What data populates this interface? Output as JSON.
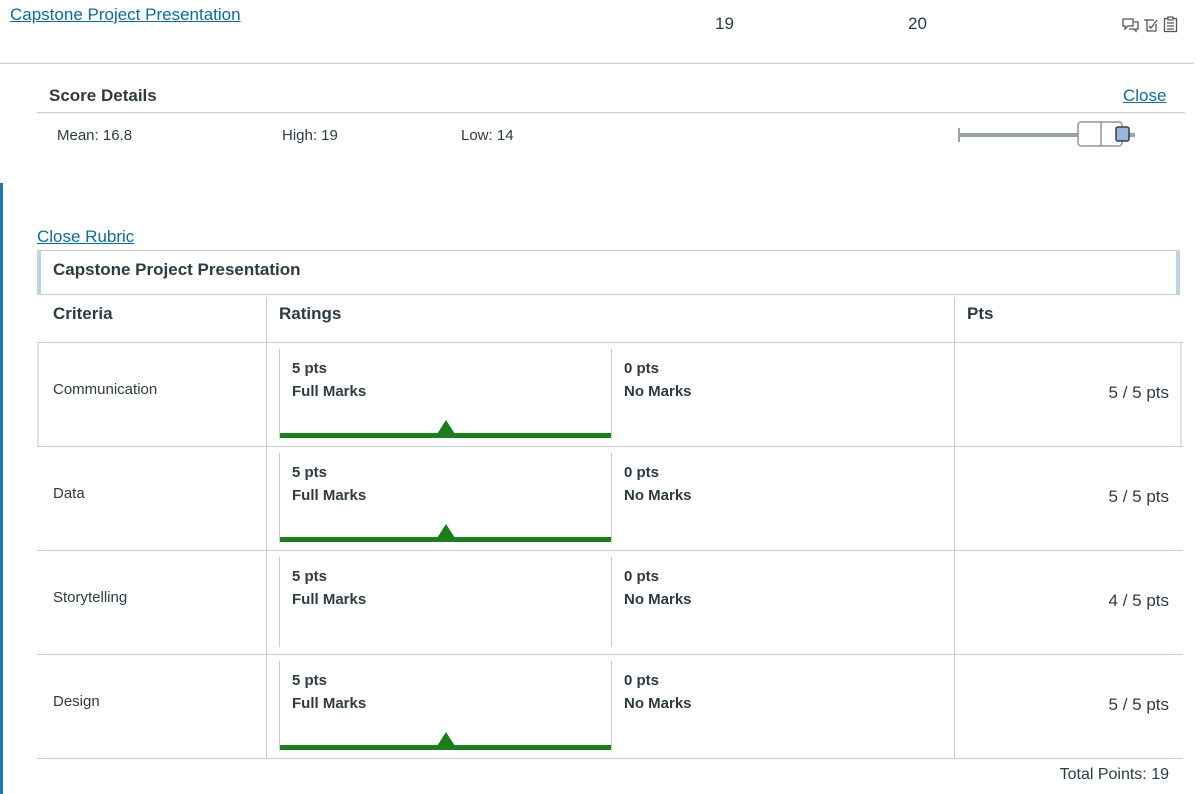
{
  "assignment": {
    "title": "Capstone Project Presentation",
    "score": "19",
    "out_of": "20"
  },
  "row_icons": [
    "comment-icon",
    "rubric-check-icon",
    "clipboard-icon"
  ],
  "score_details": {
    "title": "Score Details",
    "close_label": "Close",
    "mean": "Mean: 16.8",
    "high": "High: 19",
    "low": "Low: 14"
  },
  "rubric": {
    "close_label": "Close Rubric",
    "title": "Capstone Project Presentation",
    "columns": {
      "criteria": "Criteria",
      "ratings": "Ratings",
      "pts": "Pts"
    },
    "rows": [
      {
        "name": "Communication",
        "r1_pts": "5 pts",
        "r1_label": "Full Marks",
        "r2_pts": "0 pts",
        "r2_label": "No Marks",
        "score": "5 / 5 pts",
        "selected": true
      },
      {
        "name": "Data",
        "r1_pts": "5 pts",
        "r1_label": "Full Marks",
        "r2_pts": "0 pts",
        "r2_label": "No Marks",
        "score": "5 / 5 pts",
        "selected": true
      },
      {
        "name": "Storytelling",
        "r1_pts": "5 pts",
        "r1_label": "Full Marks",
        "r2_pts": "0 pts",
        "r2_label": "No Marks",
        "score": "4 / 5 pts",
        "selected": false
      },
      {
        "name": "Design",
        "r1_pts": "5 pts",
        "r1_label": "Full Marks",
        "r2_pts": "0 pts",
        "r2_label": "No Marks",
        "score": "5 / 5 pts",
        "selected": true
      }
    ],
    "total": "Total Points: 19"
  },
  "colors": {
    "link": "#0b6d95",
    "selected": "#1b7d1b",
    "accent": "#1b78b1"
  }
}
